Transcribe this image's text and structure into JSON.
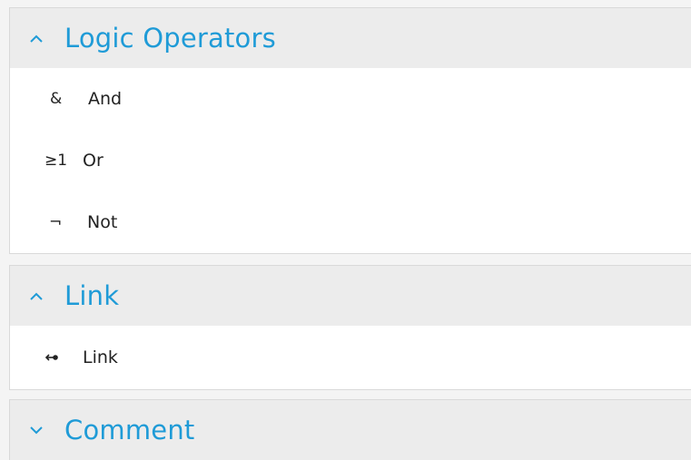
{
  "accent_color": "#1f9bd7",
  "sections": [
    {
      "title": "Logic Operators",
      "expanded": true,
      "items": [
        {
          "symbol": "&",
          "label": "And",
          "icon": "ampersand-icon"
        },
        {
          "symbol": "≥1",
          "label": "Or",
          "icon": "greater-equal-one-icon"
        },
        {
          "symbol": "¬",
          "label": "Not",
          "icon": "not-sign-icon"
        }
      ]
    },
    {
      "title": "Link",
      "expanded": true,
      "items": [
        {
          "label": "Link",
          "icon": "link-arrow-icon"
        }
      ]
    },
    {
      "title": "Comment",
      "expanded": false,
      "items": []
    }
  ]
}
